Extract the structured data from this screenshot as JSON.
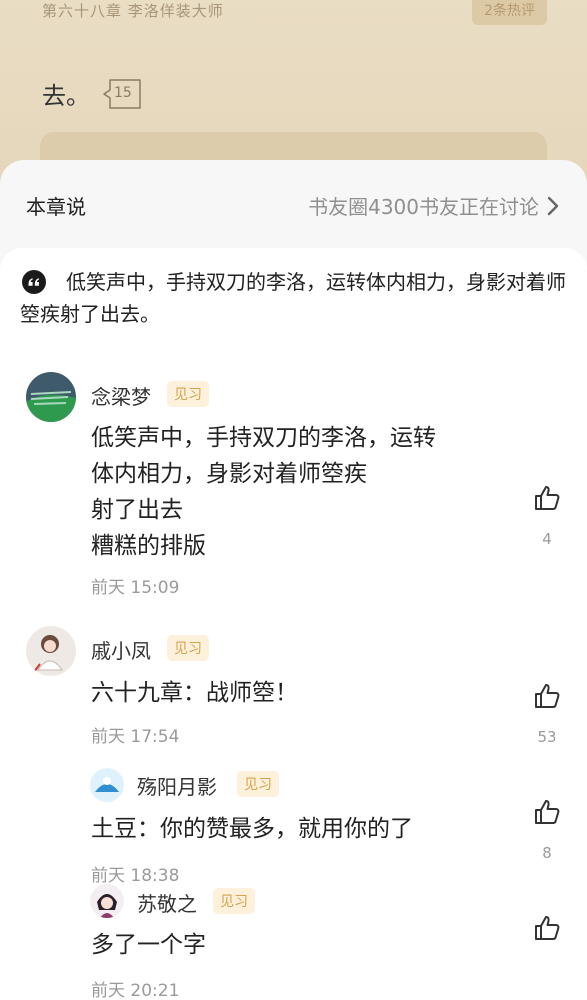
{
  "reader": {
    "chapter_title": "第六十八章 李洛佯装大师",
    "hot_comments_badge": "2条热评",
    "text": "去。",
    "paragraph_comment_count": "15"
  },
  "sheet": {
    "title": "本章说",
    "discussion_link": "书友圈4300书友正在讨论",
    "quote": "低笑声中，手持双刀的李洛，运转体内相力，身影对着师箜疾射了出去。"
  },
  "comments": [
    {
      "username": "念梁梦",
      "badge": "见习",
      "text": "低笑声中，手持双刀的李洛，运转\n体内相力，身影对着师箜疾\n射了出去\n糟糕的排版",
      "time": "前天 15:09",
      "likes": "4"
    },
    {
      "username": "戚小凤",
      "badge": "见习",
      "text": "六十九章：战师箜！",
      "time": "前天 17:54",
      "likes": "53"
    },
    {
      "username": "殇阳月影",
      "badge": "见习",
      "text": "土豆：你的赞最多，就用你的了",
      "time": "前天 18:38",
      "likes": "8"
    },
    {
      "username": "苏敬之",
      "badge": "见习",
      "text": "多了一个字",
      "time": "前天 20:21",
      "likes": ""
    }
  ],
  "colors": {
    "reader_bg": "#e8dcc2",
    "badge_text": "#d9a24b",
    "badge_bg": "#fdf1dc",
    "muted_text": "#9a9a9a"
  },
  "icons": [
    "quote-icon",
    "chevron-right-icon",
    "thumbs-up-icon",
    "speech-bubble-icon"
  ]
}
